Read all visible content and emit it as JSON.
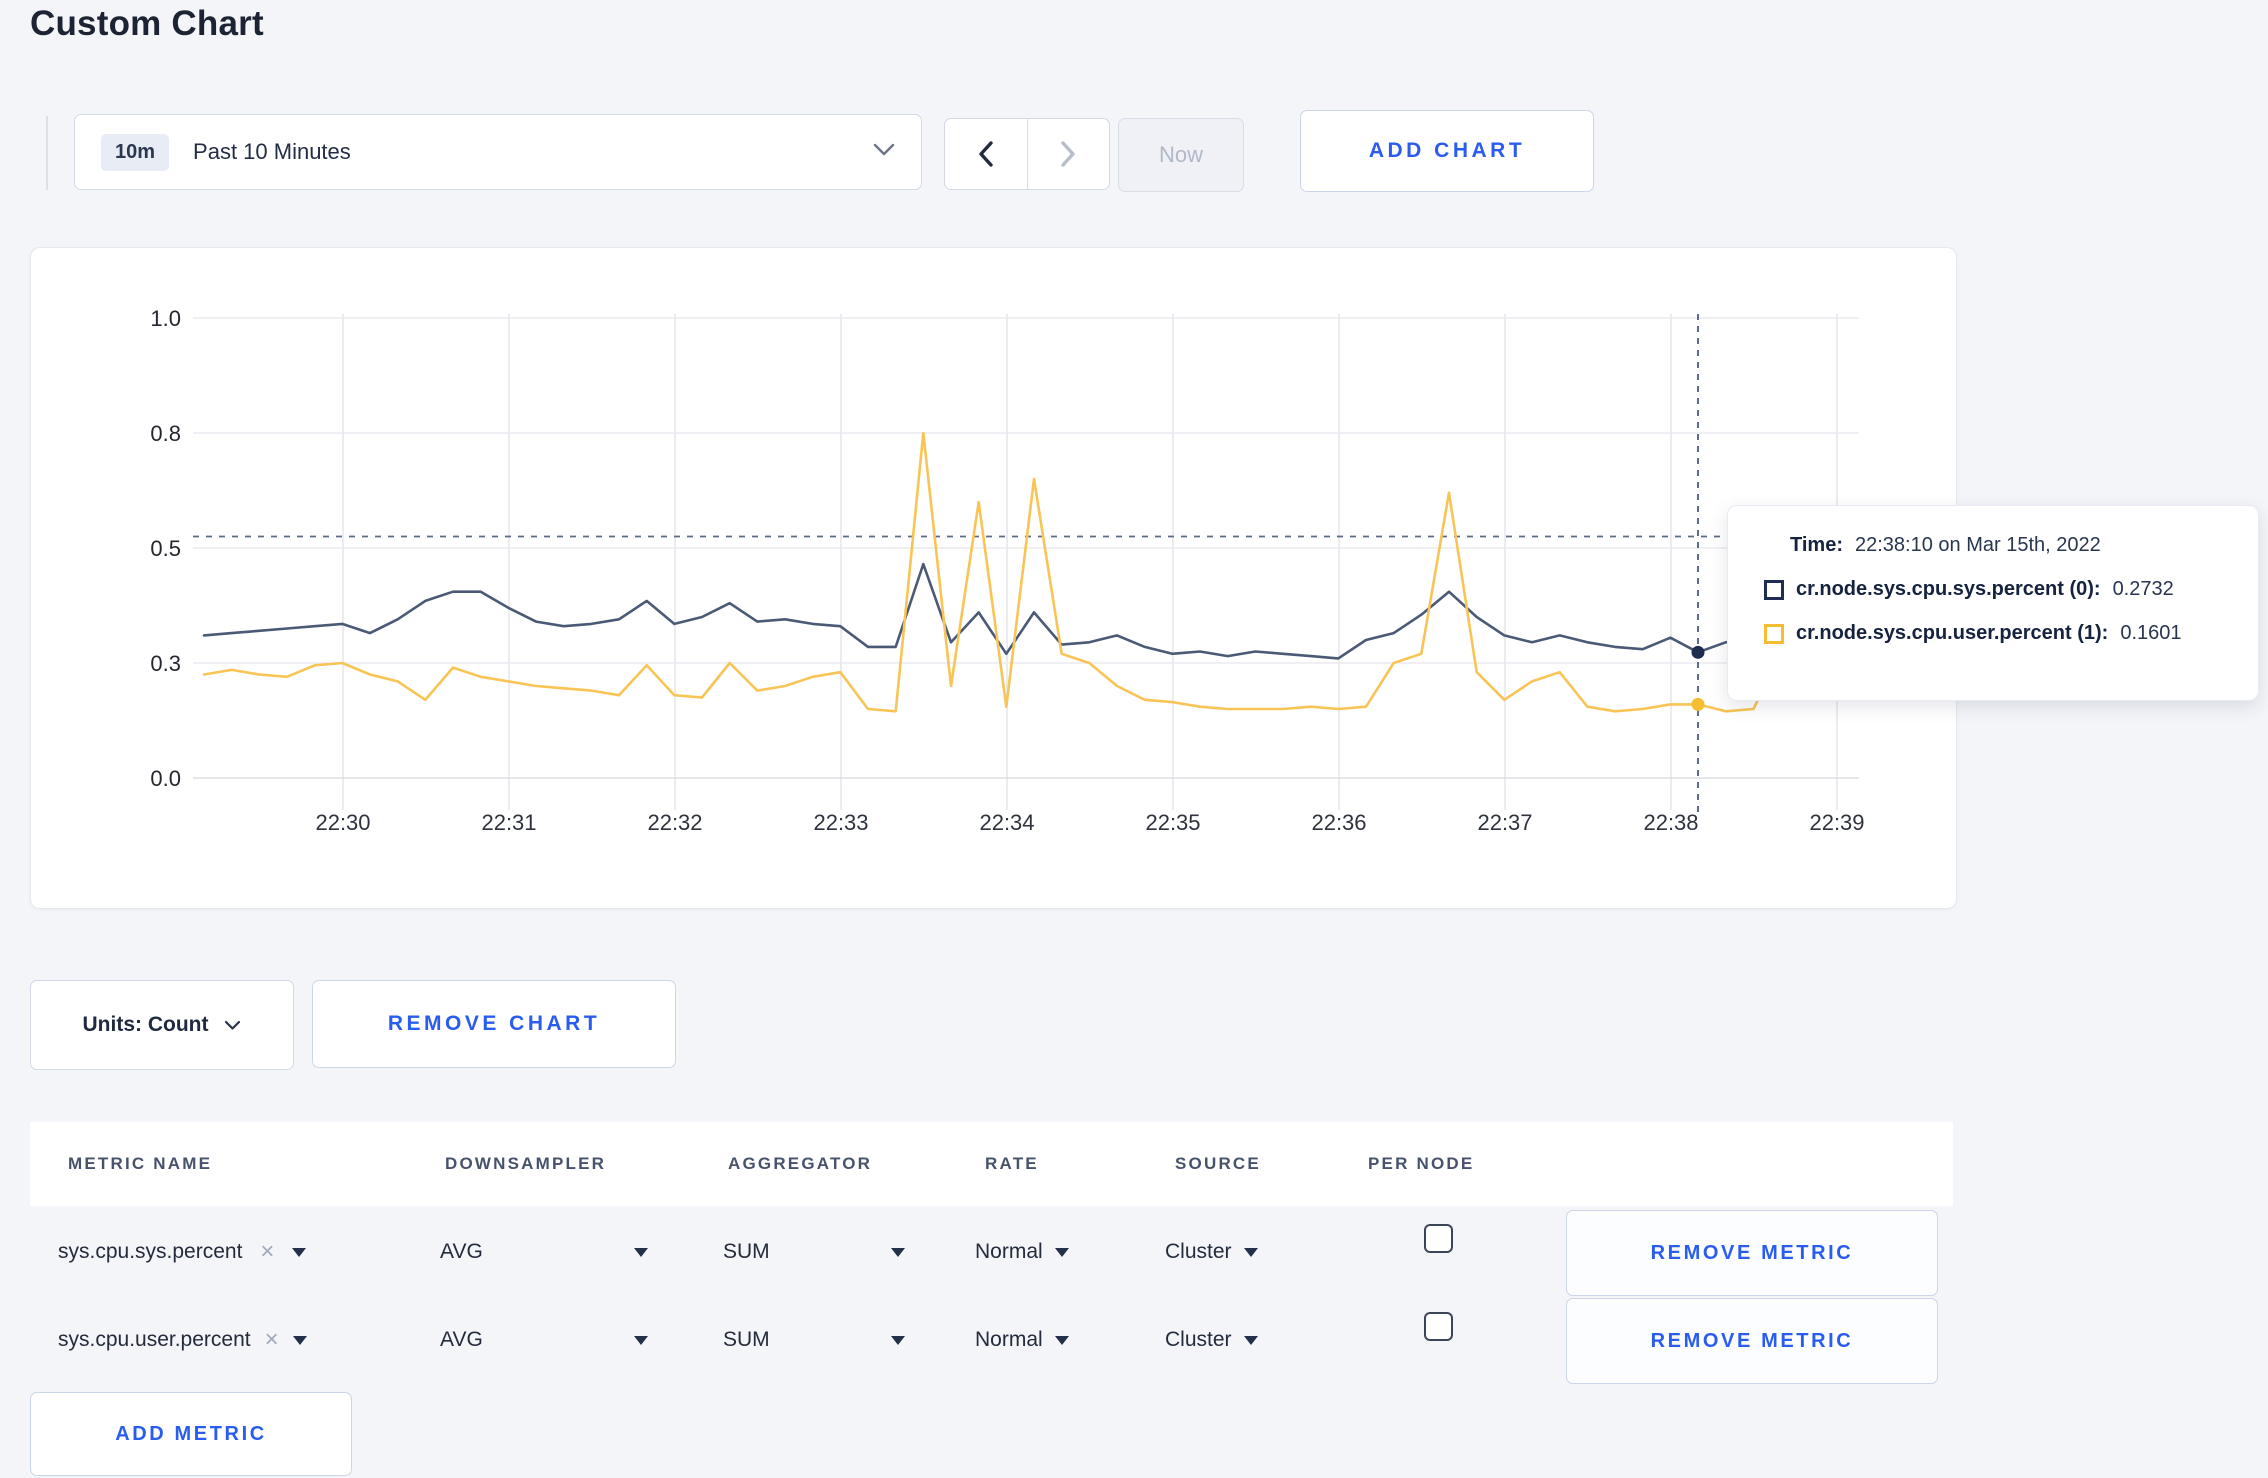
{
  "page": {
    "title": "Custom Chart",
    "background": "#f4f5f9",
    "accent_blue": "#2b5cf0"
  },
  "toolbar": {
    "time_range": {
      "badge": "10m",
      "label": "Past 10 Minutes"
    },
    "prev_icon": "chevron-left",
    "next_icon": "chevron-right",
    "now_label": "Now",
    "add_chart_label": "ADD CHART"
  },
  "tooltip": {
    "time_label": "Time:",
    "time_value": "22:38:10 on Mar 15th, 2022",
    "rows": [
      {
        "name": "cr.node.sys.cpu.sys.percent (0):",
        "value": "0.2732"
      },
      {
        "name": "cr.node.sys.cpu.user.percent (1):",
        "value": "0.1601"
      }
    ]
  },
  "chart_data": {
    "type": "line",
    "title": "",
    "xlabel": "",
    "ylabel": "",
    "ylim": [
      0,
      1
    ],
    "grid": true,
    "legend_position": "tooltip",
    "y_tick_labels": [
      "0.0",
      "0.3",
      "0.5",
      "0.8",
      "1.0"
    ],
    "y_tick_values": [
      0,
      0.25,
      0.5,
      0.75,
      1.0
    ],
    "x_tick_labels": [
      "22:30",
      "22:31",
      "22:32",
      "22:33",
      "22:34",
      "22:35",
      "22:36",
      "22:37",
      "22:38",
      "22:39"
    ],
    "times": [
      "22:29:10",
      "22:29:20",
      "22:29:30",
      "22:29:40",
      "22:29:50",
      "22:30:00",
      "22:30:10",
      "22:30:20",
      "22:30:30",
      "22:30:40",
      "22:30:50",
      "22:31:00",
      "22:31:10",
      "22:31:20",
      "22:31:30",
      "22:31:40",
      "22:31:50",
      "22:32:00",
      "22:32:10",
      "22:32:20",
      "22:32:30",
      "22:32:40",
      "22:32:50",
      "22:33:00",
      "22:33:10",
      "22:33:20",
      "22:33:30",
      "22:33:40",
      "22:33:50",
      "22:34:00",
      "22:34:10",
      "22:34:20",
      "22:34:30",
      "22:34:40",
      "22:34:50",
      "22:35:00",
      "22:35:10",
      "22:35:20",
      "22:35:30",
      "22:35:40",
      "22:35:50",
      "22:36:00",
      "22:36:10",
      "22:36:20",
      "22:36:30",
      "22:36:40",
      "22:36:50",
      "22:37:00",
      "22:37:10",
      "22:37:20",
      "22:37:30",
      "22:37:40",
      "22:37:50",
      "22:38:00",
      "22:38:10",
      "22:38:20",
      "22:38:30",
      "22:38:40",
      "22:38:50",
      "22:39:00"
    ],
    "series": [
      {
        "name": "cr.node.sys.cpu.sys.percent (0)",
        "color": "#4a5a76",
        "swatch": "#1f2d50",
        "values": [
          0.31,
          0.315,
          0.32,
          0.325,
          0.33,
          0.335,
          0.315,
          0.345,
          0.385,
          0.405,
          0.405,
          0.37,
          0.34,
          0.33,
          0.335,
          0.345,
          0.385,
          0.335,
          0.35,
          0.38,
          0.34,
          0.345,
          0.335,
          0.33,
          0.285,
          0.285,
          0.465,
          0.295,
          0.36,
          0.27,
          0.36,
          0.29,
          0.295,
          0.31,
          0.285,
          0.27,
          0.275,
          0.265,
          0.275,
          0.27,
          0.265,
          0.26,
          0.3,
          0.315,
          0.355,
          0.405,
          0.35,
          0.31,
          0.295,
          0.31,
          0.295,
          0.285,
          0.28,
          0.305,
          0.2732,
          0.295,
          0.3,
          0.31,
          0.305,
          0.31
        ]
      },
      {
        "name": "cr.node.sys.cpu.user.percent (1)",
        "color": "#f8c455",
        "swatch": "#f5bd32",
        "values": [
          0.225,
          0.235,
          0.225,
          0.22,
          0.245,
          0.25,
          0.225,
          0.21,
          0.17,
          0.24,
          0.22,
          0.21,
          0.2,
          0.195,
          0.19,
          0.18,
          0.245,
          0.18,
          0.175,
          0.25,
          0.19,
          0.2,
          0.22,
          0.23,
          0.15,
          0.145,
          0.75,
          0.2,
          0.6,
          0.155,
          0.65,
          0.27,
          0.25,
          0.2,
          0.17,
          0.165,
          0.155,
          0.15,
          0.15,
          0.15,
          0.155,
          0.15,
          0.155,
          0.25,
          0.27,
          0.62,
          0.23,
          0.17,
          0.21,
          0.23,
          0.155,
          0.145,
          0.15,
          0.16,
          0.1601,
          0.145,
          0.15,
          0.27,
          0.27,
          0.245
        ]
      }
    ],
    "crosshair": {
      "index": 54,
      "time": "22:38:10"
    },
    "hover_line_value": 0.525
  },
  "units_row": {
    "units_label": "Units: Count",
    "remove_chart_label": "REMOVE CHART"
  },
  "metrics_table": {
    "headers": [
      "METRIC NAME",
      "DOWNSAMPLER",
      "AGGREGATOR",
      "RATE",
      "SOURCE",
      "PER NODE"
    ],
    "rows": [
      {
        "metric": "sys.cpu.sys.percent",
        "downsampler": "AVG",
        "aggregator": "SUM",
        "rate": "Normal",
        "source": "Cluster",
        "per_node_checked": false,
        "remove_label": "REMOVE METRIC"
      },
      {
        "metric": "sys.cpu.user.percent",
        "downsampler": "AVG",
        "aggregator": "SUM",
        "rate": "Normal",
        "source": "Cluster",
        "per_node_checked": false,
        "remove_label": "REMOVE METRIC"
      }
    ],
    "add_metric_label": "ADD METRIC"
  }
}
